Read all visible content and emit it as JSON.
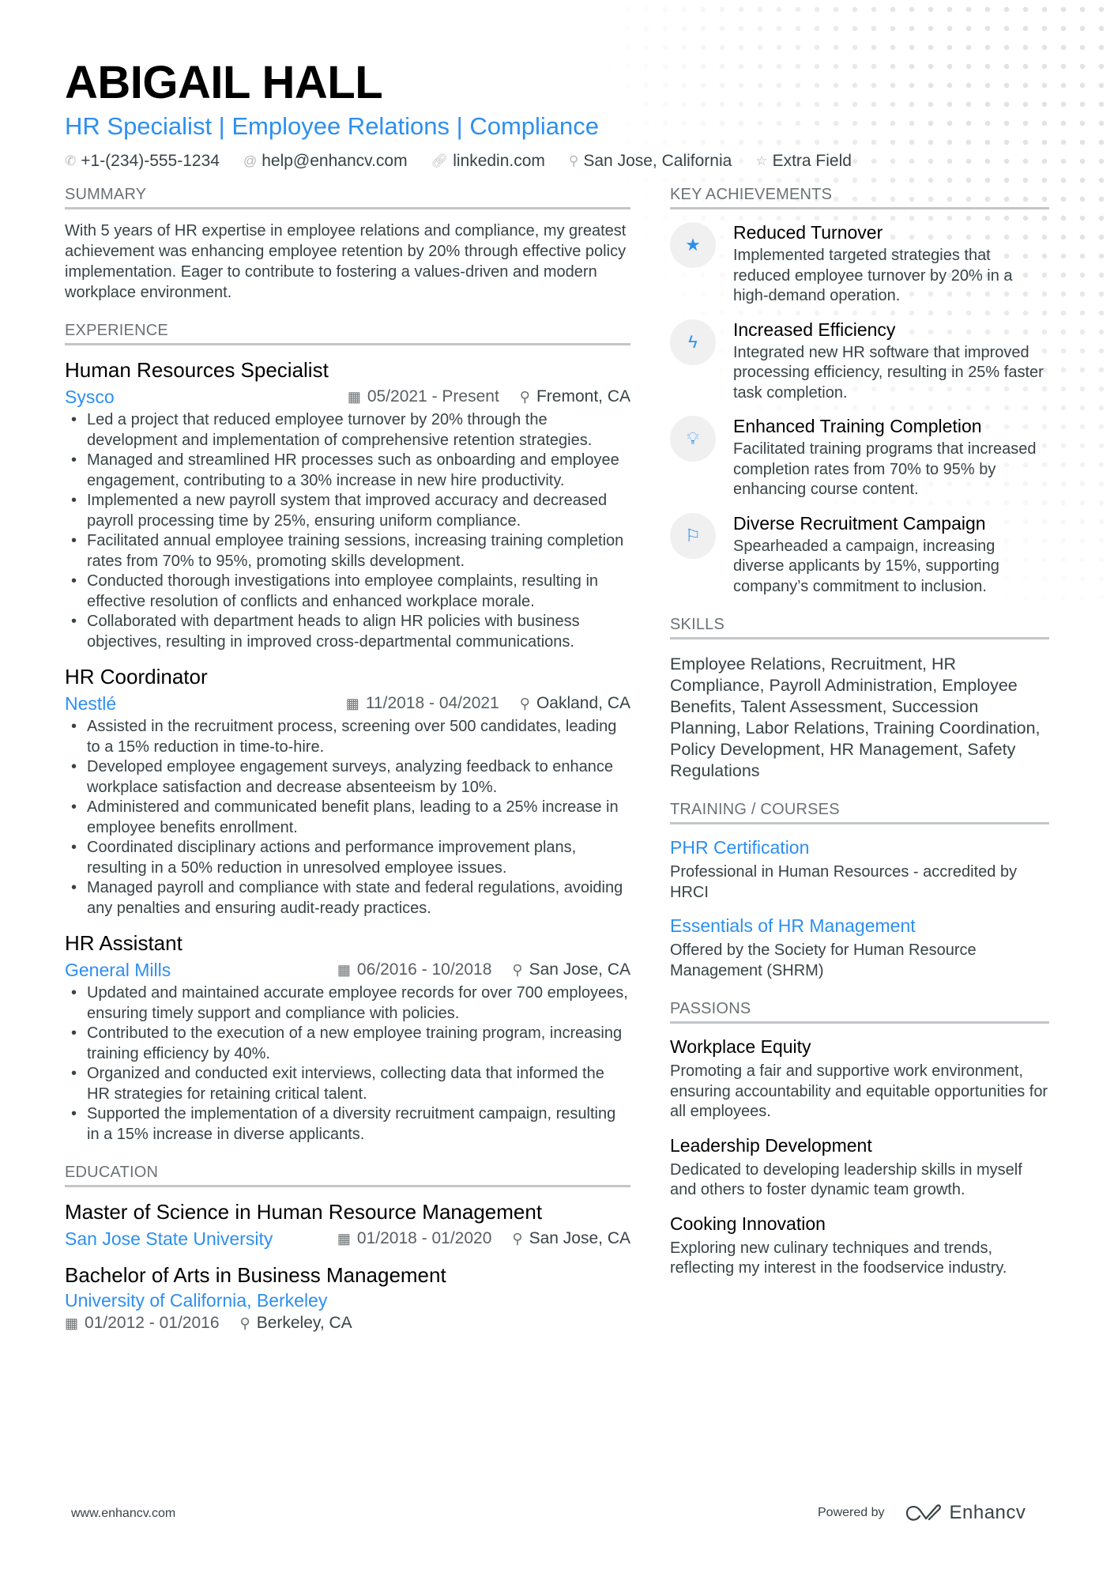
{
  "header": {
    "name": "ABIGAIL HALL",
    "headline": "HR Specialist | Employee Relations | Compliance",
    "contacts": [
      {
        "icon": "phone-icon",
        "glyph": "✆",
        "text": "+1-(234)-555-1234"
      },
      {
        "icon": "at-icon",
        "glyph": "@",
        "text": "help@enhancv.com"
      },
      {
        "icon": "link-icon",
        "glyph": "🔗︎",
        "text": "linkedin.com"
      },
      {
        "icon": "location-icon",
        "glyph": "⚲",
        "text": "San Jose, California"
      },
      {
        "icon": "star-icon",
        "glyph": "☆",
        "text": "Extra Field"
      }
    ]
  },
  "colors": {
    "accent": "#2d8ff0",
    "text": "#384347",
    "heading": "#000000",
    "muted": "#6b7275"
  },
  "summary": {
    "title": "SUMMARY",
    "text": "With 5 years of HR expertise in employee relations and compliance, my greatest achievement was enhancing employee retention by 20% through effective policy implementation. Eager to contribute to fostering a values-driven and modern workplace environment."
  },
  "experience": {
    "title": "EXPERIENCE",
    "jobs": [
      {
        "title": "Human Resources Specialist",
        "company": "Sysco",
        "dates": "05/2021 - Present",
        "location": "Fremont, CA",
        "bullets": [
          "Led a project that reduced employee turnover by 20% through the development and implementation of comprehensive retention strategies.",
          "Managed and streamlined HR processes such as onboarding and employee engagement, contributing to a 30% increase in new hire productivity.",
          "Implemented a new payroll system that improved accuracy and decreased payroll processing time by 25%, ensuring uniform compliance.",
          "Facilitated annual employee training sessions, increasing training completion rates from 70% to 95%, promoting skills development.",
          "Conducted thorough investigations into employee complaints, resulting in effective resolution of conflicts and enhanced workplace morale.",
          "Collaborated with department heads to align HR policies with business objectives, resulting in improved cross-departmental communications."
        ]
      },
      {
        "title": "HR Coordinator",
        "company": "Nestlé",
        "dates": "11/2018 - 04/2021",
        "location": "Oakland, CA",
        "bullets": [
          "Assisted in the recruitment process, screening over 500 candidates, leading to a 15% reduction in time-to-hire.",
          "Developed employee engagement surveys, analyzing feedback to enhance workplace satisfaction and decrease absenteeism by 10%.",
          "Administered and communicated benefit plans, leading to a 25% increase in employee benefits enrollment.",
          "Coordinated disciplinary actions and performance improvement plans, resulting in a 50% reduction in unresolved employee issues.",
          "Managed payroll and compliance with state and federal regulations, avoiding any penalties and ensuring audit-ready practices."
        ]
      },
      {
        "title": "HR Assistant",
        "company": "General Mills",
        "dates": "06/2016 - 10/2018",
        "location": "San Jose, CA",
        "bullets": [
          "Updated and maintained accurate employee records for over 700 employees, ensuring timely support and compliance with policies.",
          "Contributed to the execution of a new employee training program, increasing training efficiency by 40%.",
          "Organized and conducted exit interviews, collecting data that informed the HR strategies for retaining critical talent.",
          "Supported the implementation of a diversity recruitment campaign, resulting in a 15% increase in diverse applicants."
        ]
      }
    ]
  },
  "education": {
    "title": "EDUCATION",
    "items": [
      {
        "degree": "Master of Science in Human Resource Management",
        "school": "San Jose State University",
        "dates": "01/2018 - 01/2020",
        "location": "San Jose, CA"
      },
      {
        "degree": "Bachelor of Arts in Business Management",
        "school": "University of California, Berkeley",
        "dates": "01/2012 - 01/2016",
        "location": "Berkeley, CA"
      }
    ]
  },
  "achievements": {
    "title": "KEY ACHIEVEMENTS",
    "items": [
      {
        "icon": "star-icon",
        "glyph": "★",
        "title": "Reduced Turnover",
        "desc": "Implemented targeted strategies that reduced employee turnover by 20% in a high-demand operation."
      },
      {
        "icon": "lightning-icon",
        "glyph": "ϟ",
        "title": "Increased Efficiency",
        "desc": "Integrated new HR software that improved processing efficiency, resulting in 25% faster task completion."
      },
      {
        "icon": "lightbulb-icon",
        "glyph": "💡︎",
        "title": "Enhanced Training Completion",
        "desc": "Facilitated training programs that increased completion rates from 70% to 95% by enhancing course content."
      },
      {
        "icon": "flag-icon",
        "glyph": "⚐",
        "title": "Diverse Recruitment Campaign",
        "desc": "Spearheaded a campaign, increasing diverse applicants by 15%, supporting company’s commitment to inclusion."
      }
    ]
  },
  "skills": {
    "title": "SKILLS",
    "text": "Employee Relations, Recruitment, HR Compliance, Payroll Administration, Employee Benefits, Talent Assessment, Succession Planning, Labor Relations, Training Coordination, Policy Development, HR Management, Safety Regulations"
  },
  "training": {
    "title": "TRAINING / COURSES",
    "items": [
      {
        "title": "PHR Certification",
        "desc": "Professional in Human Resources - accredited by HRCI"
      },
      {
        "title": "Essentials of HR Management",
        "desc": "Offered by the Society for Human Resource Management (SHRM)"
      }
    ]
  },
  "passions": {
    "title": "PASSIONS",
    "items": [
      {
        "title": "Workplace Equity",
        "desc": "Promoting a fair and supportive work environment, ensuring accountability and equitable opportunities for all employees."
      },
      {
        "title": "Leadership Development",
        "desc": "Dedicated to developing leadership skills in myself and others to foster dynamic team growth."
      },
      {
        "title": "Cooking Innovation",
        "desc": "Exploring new culinary techniques and trends, reflecting my interest in the foodservice industry."
      }
    ]
  },
  "footer": {
    "website": "www.enhancv.com",
    "powered_by": "Powered by",
    "brand": "Enhancv"
  }
}
